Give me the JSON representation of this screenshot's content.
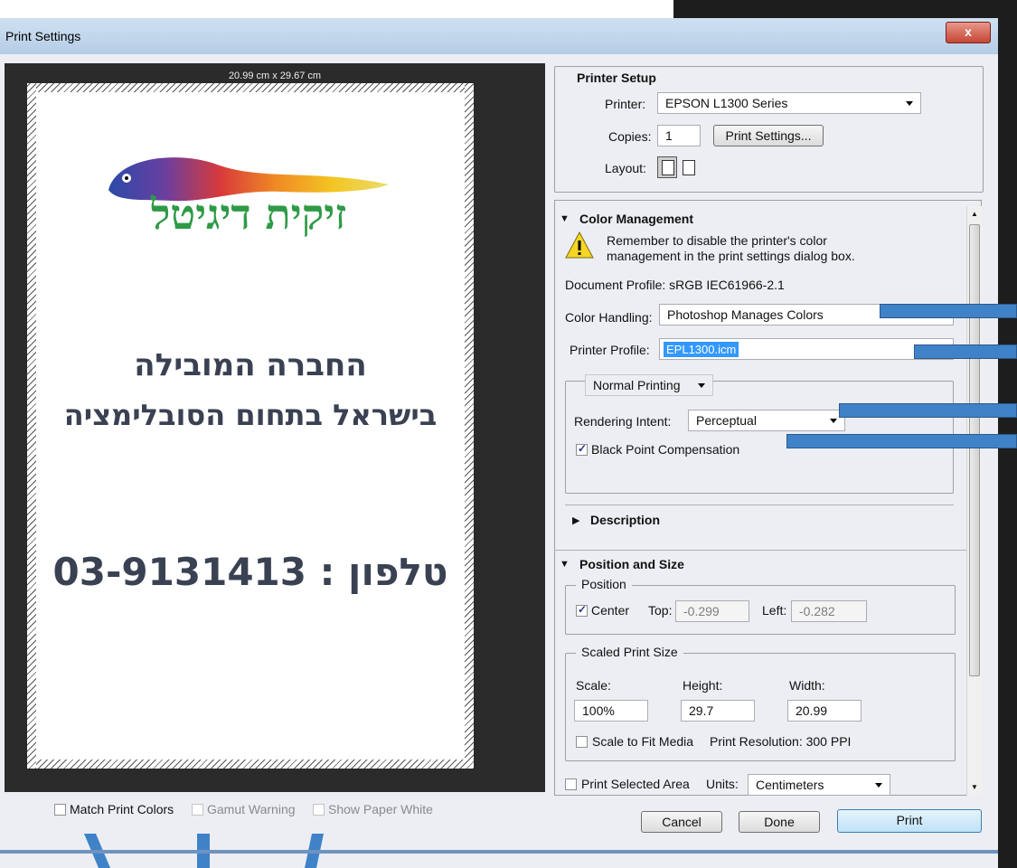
{
  "window": {
    "title": "Print Settings",
    "close_label": "x"
  },
  "preview": {
    "paper_size": "20.99 cm x 29.67 cm",
    "logo_text": "זיקית דיגיטל",
    "headline_line1": "החברה המובילה",
    "headline_line2": "בישראל בתחום הסובלימציה",
    "phone_line": "טלפון : 03-9131413"
  },
  "bottom_options": [
    {
      "label": "Match Print Colors",
      "checked": false,
      "enabled": true
    },
    {
      "label": "Gamut Warning",
      "checked": false,
      "enabled": false
    },
    {
      "label": "Show Paper White",
      "checked": false,
      "enabled": false
    }
  ],
  "printer_setup": {
    "heading": "Printer Setup",
    "printer_label": "Printer:",
    "printer_value": "EPSON L1300 Series",
    "copies_label": "Copies:",
    "copies_value": "1",
    "print_settings_button": "Print Settings...",
    "layout_label": "Layout:"
  },
  "color_management": {
    "heading": "Color Management",
    "warning_text_line1": "Remember to disable the printer's color",
    "warning_text_line2": "management in the print settings dialog box.",
    "document_profile": "Document Profile: sRGB IEC61966-2.1",
    "color_handling_label": "Color Handling:",
    "color_handling_value": "Photoshop Manages Colors",
    "printer_profile_label": "Printer Profile:",
    "printer_profile_value": "EPL1300.icm",
    "mode_value": "Normal Printing",
    "rendering_intent_label": "Rendering Intent:",
    "rendering_intent_value": "Perceptual",
    "black_point_label": "Black Point Compensation",
    "black_point_checked": true
  },
  "description": {
    "heading": "Description"
  },
  "position_size": {
    "heading": "Position and Size",
    "position_group": "Position",
    "center_label": "Center",
    "center_checked": true,
    "top_label": "Top:",
    "top_value": "-0.299",
    "left_label": "Left:",
    "left_value": "-0.282",
    "scaled_group": "Scaled Print Size",
    "scale_label": "Scale:",
    "scale_value": "100%",
    "height_label": "Height:",
    "height_value": "29.7",
    "width_label": "Width:",
    "width_value": "20.99",
    "scale_to_fit_label": "Scale to Fit Media",
    "resolution_text": "Print Resolution: 300 PPI",
    "print_selected_label": "Print Selected Area",
    "units_label": "Units:",
    "units_value": "Centimeters"
  },
  "buttons": {
    "cancel": "Cancel",
    "done": "Done",
    "print": "Print"
  },
  "colors": {
    "annotation_arrow": "#3f82c8",
    "selection": "#3399ff",
    "title_bar": "#c4d7ec"
  }
}
